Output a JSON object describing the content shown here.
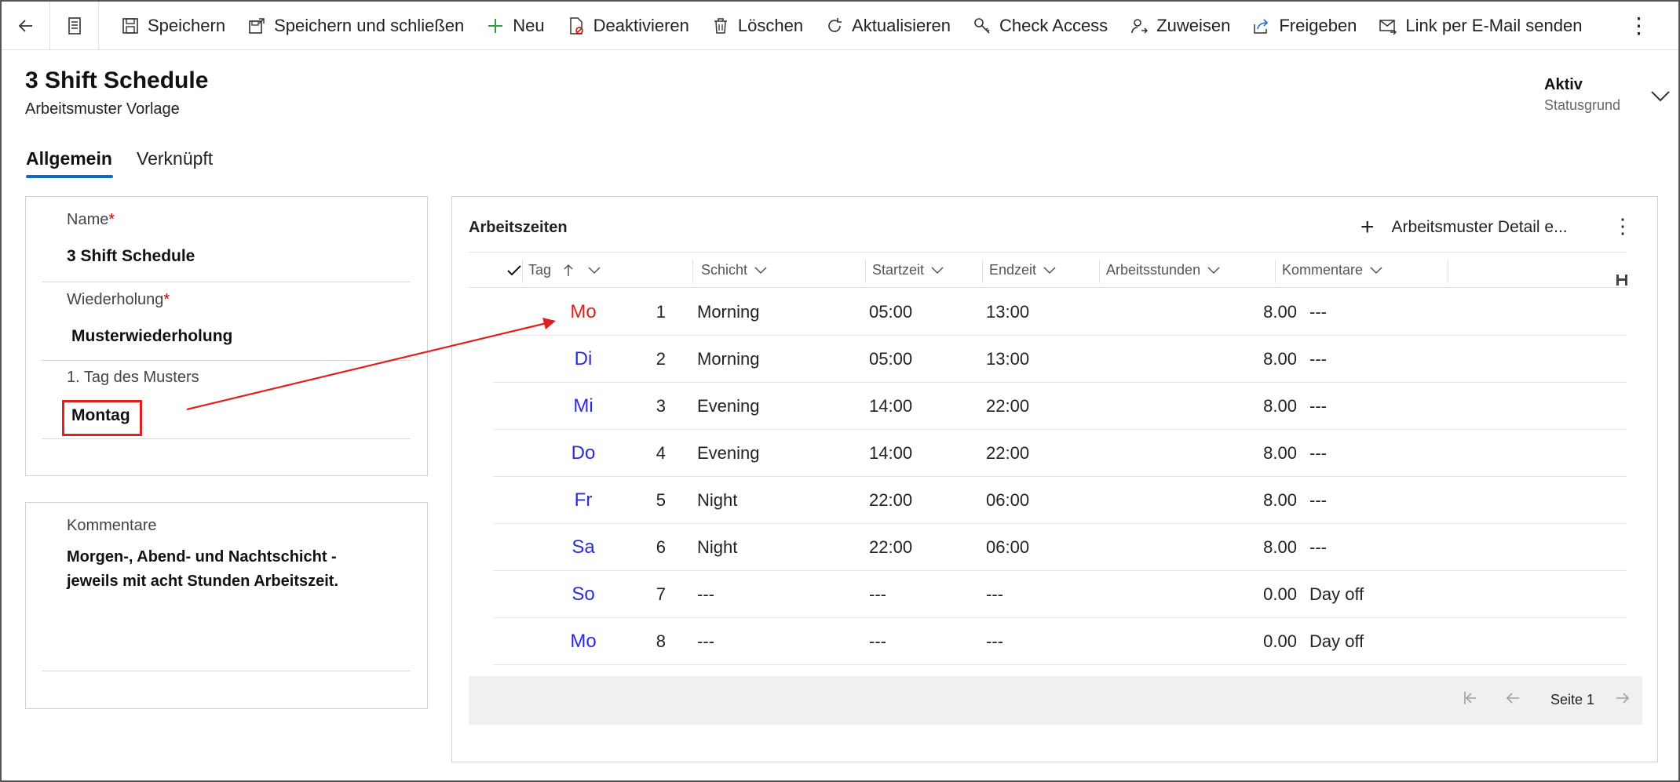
{
  "toolbar": {
    "items": [
      {
        "label": "Speichern",
        "icon": "save-icon"
      },
      {
        "label": "Speichern und schließen",
        "icon": "save-close-icon"
      },
      {
        "label": "Neu",
        "icon": "plus-icon"
      },
      {
        "label": "Deaktivieren",
        "icon": "deactivate-icon"
      },
      {
        "label": "Löschen",
        "icon": "trash-icon"
      },
      {
        "label": "Aktualisieren",
        "icon": "refresh-icon"
      },
      {
        "label": "Check Access",
        "icon": "key-icon"
      },
      {
        "label": "Zuweisen",
        "icon": "assign-user-icon"
      },
      {
        "label": "Freigeben",
        "icon": "share-icon"
      },
      {
        "label": "Link per E-Mail senden",
        "icon": "email-link-icon"
      }
    ],
    "more": "⋮"
  },
  "header": {
    "title": "3 Shift Schedule",
    "subtitle": "Arbeitsmuster Vorlage",
    "status_value": "Aktiv",
    "status_label": "Statusgrund"
  },
  "tabs": [
    {
      "label": "Allgemein",
      "active": true
    },
    {
      "label": "Verknüpft",
      "active": false
    }
  ],
  "form": {
    "name_label": "Name",
    "name_value": "3 Shift Schedule",
    "repeat_label": "Wiederholung",
    "repeat_value": "Musterwiederholung",
    "first_day_label": "1. Tag des Musters",
    "first_day_value": "Montag",
    "required_mark": "*"
  },
  "comments": {
    "label": "Kommentare",
    "value_line1": "Morgen-, Abend- und Nachtschicht -",
    "value_line2": "jeweils mit acht Stunden Arbeitszeit."
  },
  "grid": {
    "title": "Arbeitszeiten",
    "add_label": "Arbeitsmuster Detail e...",
    "columns": {
      "tag": "Tag",
      "schicht": "Schicht",
      "startzeit": "Startzeit",
      "endzeit": "Endzeit",
      "arbeitsstunden": "Arbeitsstunden",
      "kommentare": "Kommentare"
    },
    "rows": [
      {
        "day": "Mo",
        "num": "1",
        "shift": "Morning",
        "start": "05:00",
        "end": "13:00",
        "hours": "8.00",
        "comment": "---"
      },
      {
        "day": "Di",
        "num": "2",
        "shift": "Morning",
        "start": "05:00",
        "end": "13:00",
        "hours": "8.00",
        "comment": "---"
      },
      {
        "day": "Mi",
        "num": "3",
        "shift": "Evening",
        "start": "14:00",
        "end": "22:00",
        "hours": "8.00",
        "comment": "---"
      },
      {
        "day": "Do",
        "num": "4",
        "shift": "Evening",
        "start": "14:00",
        "end": "22:00",
        "hours": "8.00",
        "comment": "---"
      },
      {
        "day": "Fr",
        "num": "5",
        "shift": "Night",
        "start": "22:00",
        "end": "06:00",
        "hours": "8.00",
        "comment": "---"
      },
      {
        "day": "Sa",
        "num": "6",
        "shift": "Night",
        "start": "22:00",
        "end": "06:00",
        "hours": "8.00",
        "comment": "---"
      },
      {
        "day": "So",
        "num": "7",
        "shift": "---",
        "start": "---",
        "end": "---",
        "hours": "0.00",
        "comment": "Day off"
      },
      {
        "day": "Mo",
        "num": "8",
        "shift": "---",
        "start": "---",
        "end": "---",
        "hours": "0.00",
        "comment": "Day off"
      }
    ],
    "page_label": "Seite 1"
  },
  "colors": {
    "accent": "#0f6cbd",
    "annotation_red": "#e02020",
    "day_blue": "#2a2ae0",
    "day_highlight_red": "#e02020"
  }
}
